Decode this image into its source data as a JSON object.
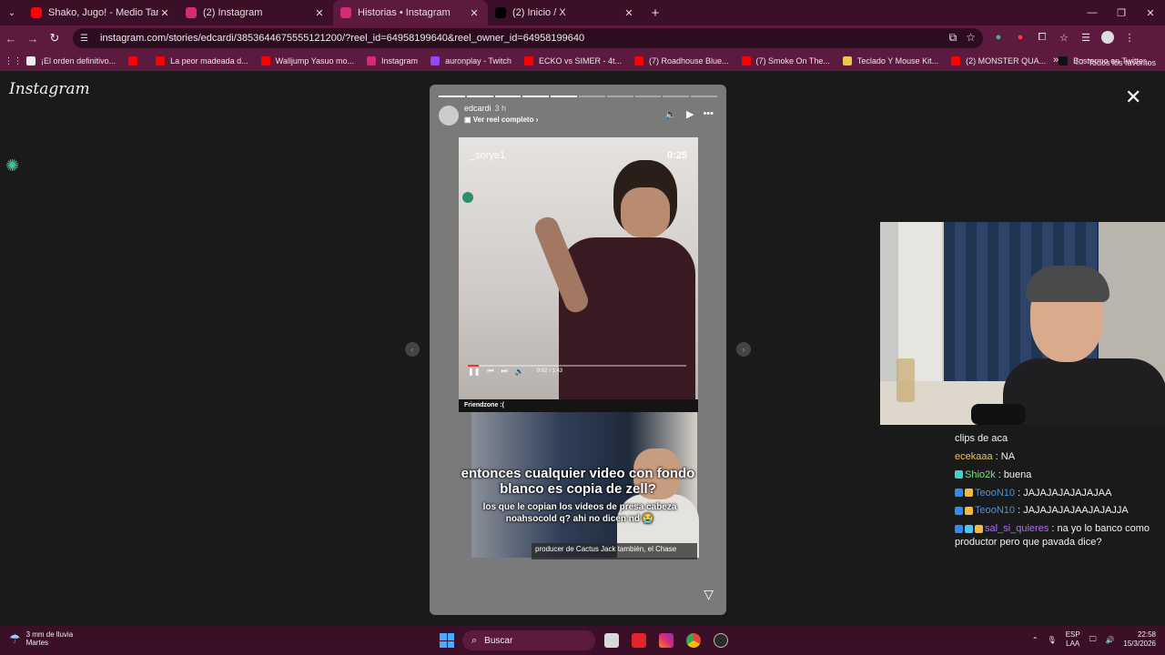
{
  "browser": {
    "tabs": [
      {
        "title": "Shako, Jugo! - Medio Tana (Vid",
        "color": "#ff0000",
        "active": false
      },
      {
        "title": "(2) Instagram",
        "color": "#d62976",
        "active": false
      },
      {
        "title": "Historias • Instagram",
        "color": "#d62976",
        "active": true
      },
      {
        "title": "(2) Inicio / X",
        "color": "#000000",
        "active": false
      }
    ],
    "new_tab": "+",
    "url": "instagram.com/stories/edcardi/3853644675555121200/?reel_id=64958199640&reel_owner_id=64958199640",
    "bookmarks": [
      {
        "label": "¡El orden definitivo...",
        "color": "#eeeeee"
      },
      {
        "label": "",
        "color": "#ff0000"
      },
      {
        "label": "La peor madeada d...",
        "color": "#ff0000"
      },
      {
        "label": "Walljump Yasuo mo...",
        "color": "#ff0000"
      },
      {
        "label": "Instagram",
        "color": "#d62976"
      },
      {
        "label": "auronplay - Twitch",
        "color": "#9146ff"
      },
      {
        "label": "ECKO vs SIMER - 4t...",
        "color": "#ff0000"
      },
      {
        "label": "(7) Roadhouse Blue...",
        "color": "#ff0000"
      },
      {
        "label": "(7) Smoke On The...",
        "color": "#ff0000"
      },
      {
        "label": "Teclado Y Mouse Kit...",
        "color": "#e6c84a"
      },
      {
        "label": "(2) MONSTER QUA...",
        "color": "#ff0000"
      },
      {
        "label": "Bostermo en Twitter...",
        "color": "#111111"
      }
    ],
    "bookmarks_more": "»",
    "all_favorites": "Todos los favoritos"
  },
  "instagram": {
    "logo": "Instagram",
    "close": "✕",
    "story": {
      "username": "edcardi",
      "time": "3 h",
      "reel_link": "Ver reel completo",
      "progress_total": 10,
      "progress_done": 5,
      "video_user": "_sorye1",
      "video_time": "0:25",
      "player_time": "0:02 / 1:43",
      "caption_strip": "Friendzone :(",
      "overlay_big": "entonces cualquier video con fondo blanco es copia de zell?",
      "overlay_small": "los que le copian los videos de presa cabeza noahsocold q? ahi no dicen nd 😭",
      "subtitle": "producer de Cactus Jack también, el Chase"
    }
  },
  "chat": [
    {
      "user": "",
      "user_color": "#ffffff",
      "badges": [],
      "text": "clips de aca"
    },
    {
      "user": "ecekaaa",
      "user_color": "#f0c24b",
      "badges": [],
      "text": ": NA"
    },
    {
      "user": "Shio2k",
      "user_color": "#7be08a",
      "badges": [
        "#3bd4c8"
      ],
      "text": ": buena"
    },
    {
      "user": "TeooN10",
      "user_color": "#4a90e2",
      "badges": [
        "#2b8cff",
        "#f4b942"
      ],
      "text": ": JAJAJAJAJAJAJAA"
    },
    {
      "user": "TeooN10",
      "user_color": "#4a90e2",
      "badges": [
        "#2b8cff",
        "#f4b942"
      ],
      "text": ": JAJAJAJAJAAJAJAJJA"
    },
    {
      "user": "sal_si_quieres",
      "user_color": "#b46cff",
      "badges": [
        "#2b8cff",
        "#4fc3f7",
        "#f4b942"
      ],
      "text": ": na yo lo banco como productor pero que pavada dice?"
    }
  ],
  "taskbar": {
    "weather_line1": "3 mm de lluvia",
    "weather_line2": "Martes",
    "search": "Buscar",
    "lang1": "ESP",
    "lang2": "LAA",
    "time": "22:58",
    "date": "15/3/2026"
  }
}
